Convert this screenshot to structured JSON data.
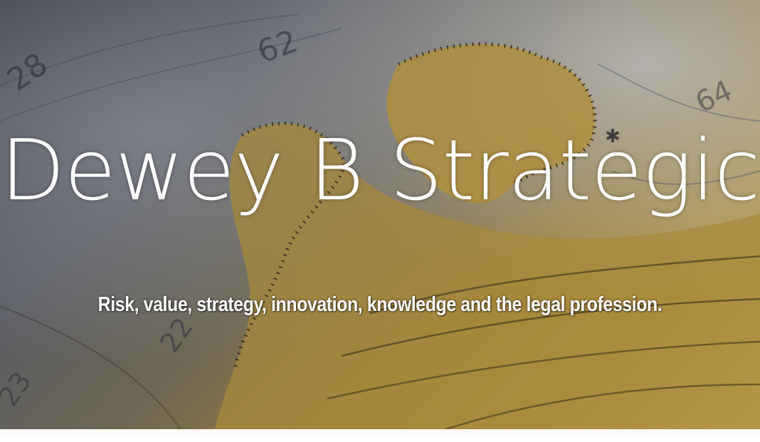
{
  "banner": {
    "title": "Dewey B Strategic",
    "tagline": "Risk, value, strategy, innovation, knowledge and the legal profession.",
    "map_numbers": [
      "28",
      "62",
      "64",
      "22",
      "23"
    ]
  },
  "colors": {
    "title_text": "#ffffff",
    "sea": "#5a5d66",
    "land": "#b99a4a",
    "footer_strip": "#fbfaf8"
  }
}
